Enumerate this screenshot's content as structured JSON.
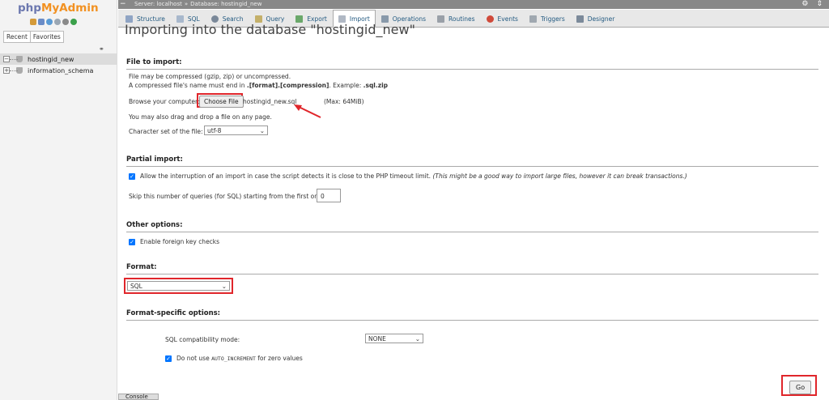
{
  "logo": {
    "php": "php",
    "myadmin": "MyAdmin"
  },
  "sidebar": {
    "tabs": [
      "Recent",
      "Favorites"
    ],
    "databases": [
      {
        "label": "hostingid_new",
        "expander": "−"
      },
      {
        "label": "information_schema",
        "expander": "+"
      }
    ]
  },
  "topbar": {
    "server": "Server: localhost",
    "separator": "»",
    "database": "Database: hostingid_new"
  },
  "tabs": [
    "Structure",
    "SQL",
    "Search",
    "Query",
    "Export",
    "Import",
    "Operations",
    "Routines",
    "Events",
    "Triggers",
    "Designer"
  ],
  "colors": {
    "accent_red": "#e0262b",
    "link_blue": "#235a81",
    "checkbox_blue": "#0075ff"
  },
  "page": {
    "heading": "Importing into the database \"hostingid_new\""
  },
  "file_import": {
    "legend": "File to import:",
    "desc1": "File may be compressed (gzip, zip) or uncompressed.",
    "desc2_prefix": "A compressed file's name must end in ",
    "desc2_format": ".[format].[compression]",
    "desc2_mid": ". Example: ",
    "desc2_example": ".sql.zip",
    "browse_label": "Browse your computer:",
    "choose_button": "Choose File",
    "file_name": "hostingid_new.sql",
    "max_size": "(Max: 64MiB)",
    "drag_text": "You may also drag and drop a file on any page.",
    "charset_label": "Character set of the file:",
    "charset_value": "utf-8"
  },
  "partial_import": {
    "legend": "Partial import:",
    "allow_interrupt": "Allow the interruption of an import in case the script detects it is close to the PHP timeout limit.",
    "allow_interrupt_note": "(This might be a good way to import large files, however it can break transactions.)",
    "skip_label": "Skip this number of queries (for SQL) starting from the first one:",
    "skip_value": "0"
  },
  "other_options": {
    "legend": "Other options:",
    "foreign_keys": "Enable foreign key checks"
  },
  "format": {
    "legend": "Format:",
    "value": "SQL"
  },
  "format_specific": {
    "legend": "Format-specific options:",
    "compat_label": "SQL compatibility mode:",
    "compat_value": "NONE",
    "auto_inc_prefix": "Do not use ",
    "auto_inc_code": "AUTO_INCREMENT",
    "auto_inc_suffix": " for zero values"
  },
  "go_button": "Go",
  "console": "Console"
}
